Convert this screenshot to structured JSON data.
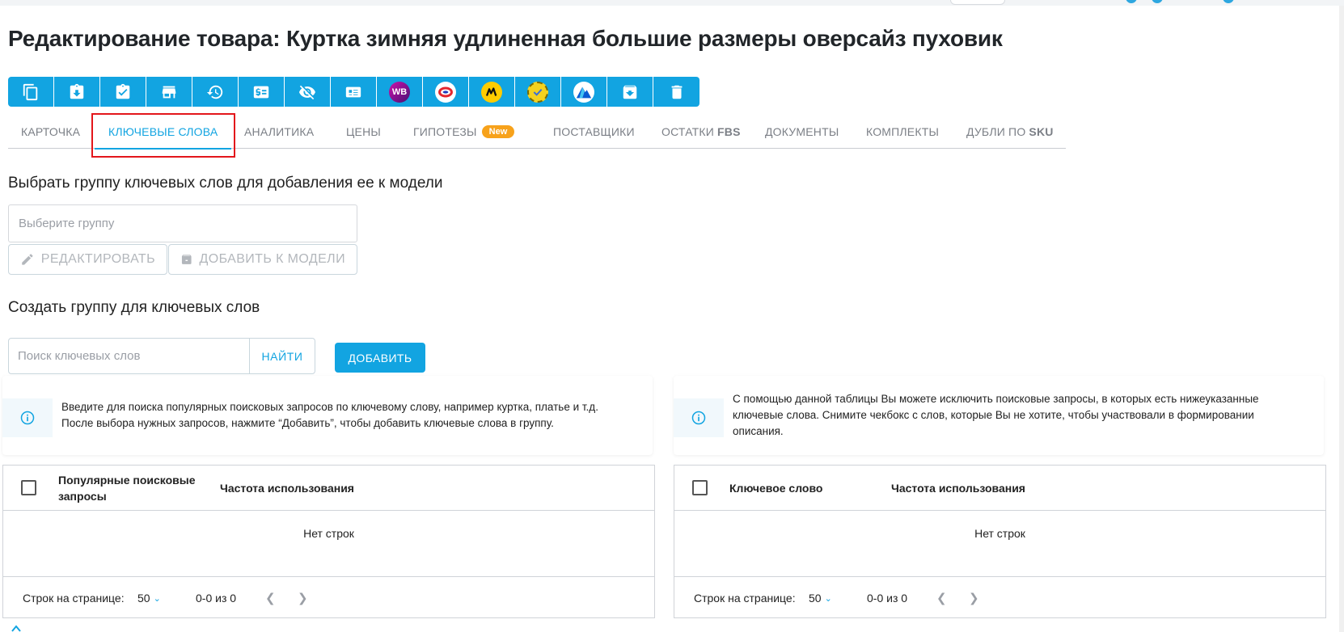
{
  "page": {
    "title": "Редактирование товара: Куртка зимняя удлиненная большие размеры оверсайз пуховик"
  },
  "toolbar": {
    "buttons": [
      {
        "icon": "copy-icon"
      },
      {
        "icon": "clipboard-download-icon"
      },
      {
        "icon": "clipboard-check-icon"
      },
      {
        "icon": "store-icon"
      },
      {
        "icon": "history-icon"
      },
      {
        "icon": "price-tag-icon"
      },
      {
        "icon": "eye-off-icon"
      },
      {
        "icon": "card-list-icon"
      },
      {
        "icon": "wildberries-icon",
        "label": "WB",
        "color": "#8b1fa9"
      },
      {
        "icon": "ozon-icon",
        "color": "#e3262e"
      },
      {
        "icon": "yandex-market-icon",
        "color": "#ffcc00"
      },
      {
        "icon": "smile-marketplace-icon",
        "color": "#f4d21f"
      },
      {
        "icon": "aliexpress-like-icon",
        "color": "#0a5bd3"
      },
      {
        "icon": "archive-download-icon"
      },
      {
        "icon": "trash-icon"
      }
    ]
  },
  "tabs": [
    {
      "label": "КАРТОЧКА"
    },
    {
      "label": "КЛЮЧЕВЫЕ СЛОВА",
      "active": true
    },
    {
      "label": "АНАЛИТИКА"
    },
    {
      "label": "ЦЕНЫ"
    },
    {
      "label": "ГИПОТЕЗЫ",
      "badge": "New"
    },
    {
      "label": "ПОСТАВЩИКИ"
    },
    {
      "label": "ОСТАТКИ",
      "bold": "FBS"
    },
    {
      "label": "ДОКУМЕНТЫ"
    },
    {
      "label": "КОМПЛЕКТЫ"
    },
    {
      "label": "ДУБЛИ ПО",
      "bold": "SKU"
    }
  ],
  "select_group": {
    "heading": "Выбрать группу ключевых слов для добавления ее к модели",
    "placeholder": "Выберите группу",
    "edit_label": "РЕДАКТИРОВАТЬ",
    "add_to_model_label": "ДОБАВИТЬ К МОДЕЛИ"
  },
  "create_group": {
    "heading": "Создать группу для ключевых слов",
    "search_placeholder": "Поиск ключевых слов",
    "search_label": "НАЙТИ",
    "add_label": "ДОБАВИТЬ"
  },
  "info_left": {
    "line1": "Введите для поиска популярных поисковых запросов по ключевому слову, например куртка, платье и т.д.",
    "line2": "После выбора нужных запросов, нажмите “Добавить”, чтобы добавить ключевые слова в группу."
  },
  "info_right": {
    "line1": "С помощью данной таблицы Вы можете исключить поисковые запросы, в которых есть нижеуказанные",
    "line2": "ключевые слова. Снимите чекбокс с слов, которые Вы не хотите, чтобы участвовали в формировании",
    "line3": "описания."
  },
  "grid_left": {
    "col1_line1": "Популярные поисковые",
    "col1_line2": "запросы",
    "col2": "Частота использования",
    "empty": "Нет строк",
    "rows_per_page_label": "Строк на странице:",
    "rows_per_page": "50",
    "range": "0-0 из 0"
  },
  "grid_right": {
    "col1": "Ключевое слово",
    "col2": "Частота использования",
    "empty": "Нет строк",
    "rows_per_page_label": "Строк на странице:",
    "rows_per_page": "50",
    "range": "0-0 из 0"
  },
  "colors": {
    "accent": "#12a4e1",
    "highlight": "#e3161b",
    "badge": "#f7a21b"
  }
}
